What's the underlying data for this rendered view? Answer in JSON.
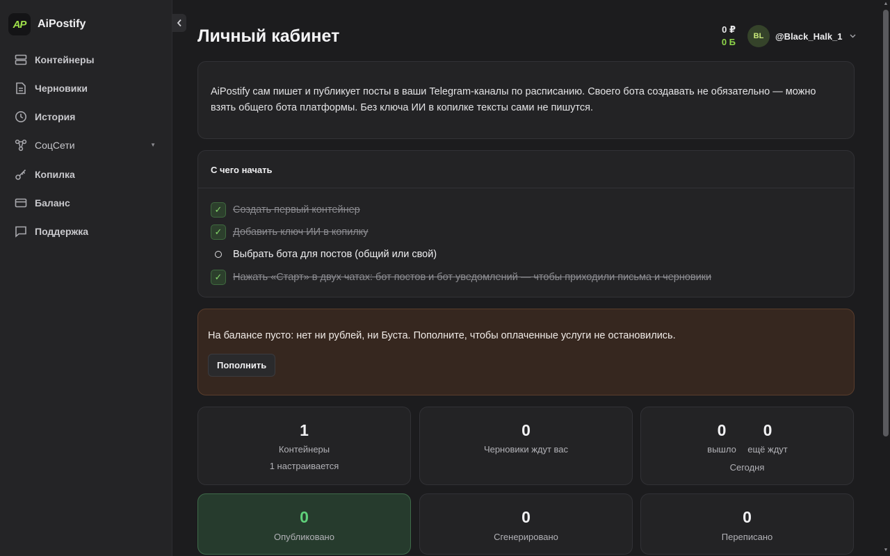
{
  "brand": {
    "logo_text": "AP",
    "name": "AiPostify"
  },
  "sidebar": {
    "items": [
      {
        "label": "Контейнеры",
        "icon": "server-icon"
      },
      {
        "label": "Черновики",
        "icon": "document-icon"
      },
      {
        "label": "История",
        "icon": "clock-icon"
      },
      {
        "label": "СоцСети",
        "icon": "network-icon",
        "has_submenu": true
      },
      {
        "label": "Копилка",
        "icon": "key-icon"
      },
      {
        "label": "Баланс",
        "icon": "card-icon"
      },
      {
        "label": "Поддержка",
        "icon": "chat-icon"
      }
    ]
  },
  "header": {
    "title": "Личный кабинет",
    "balance_rub": "0 ₽",
    "balance_boost": "0 Б",
    "avatar_initials": "BL",
    "username": "@Black_Halk_1"
  },
  "intro": {
    "text": "AiPostify сам пишет и публикует посты в ваши Telegram-каналы по расписанию. Своего бота создавать не обязательно — можно взять общего бота платформы. Без ключа ИИ в копилке тексты сами не пишутся."
  },
  "getting_started": {
    "title": "С чего начать",
    "steps": [
      {
        "label": "Создать первый контейнер",
        "done": true
      },
      {
        "label": "Добавить ключ ИИ в копилку",
        "done": true
      },
      {
        "label": "Выбрать бота для постов (общий или свой)",
        "done": false
      },
      {
        "label": "Нажать «Старт» в двух чатах: бот постов и бот уведомлений — чтобы приходили письма и черновики",
        "done": true
      }
    ]
  },
  "warning": {
    "text": "На балансе пусто: нет ни рублей, ни Буста. Пополните, чтобы оплаченные услуги не остановились.",
    "button": "Пополнить"
  },
  "stats": {
    "containers": {
      "value": "1",
      "label": "Контейнеры",
      "sub": "1 настраивается"
    },
    "drafts": {
      "value": "0",
      "label": "Черновики ждут вас"
    },
    "today": {
      "out_value": "0",
      "out_label": "вышло",
      "wait_value": "0",
      "wait_label": "ещё ждут",
      "label": "Сегодня"
    },
    "published": {
      "value": "0",
      "label": "Опубликовано"
    },
    "generated": {
      "value": "0",
      "label": "Сгенерировано"
    },
    "rewritten": {
      "value": "0",
      "label": "Переписано"
    }
  },
  "colors": {
    "accent": "#8ed64a",
    "success": "#5fd07a",
    "warning_bg": "#36271f"
  }
}
